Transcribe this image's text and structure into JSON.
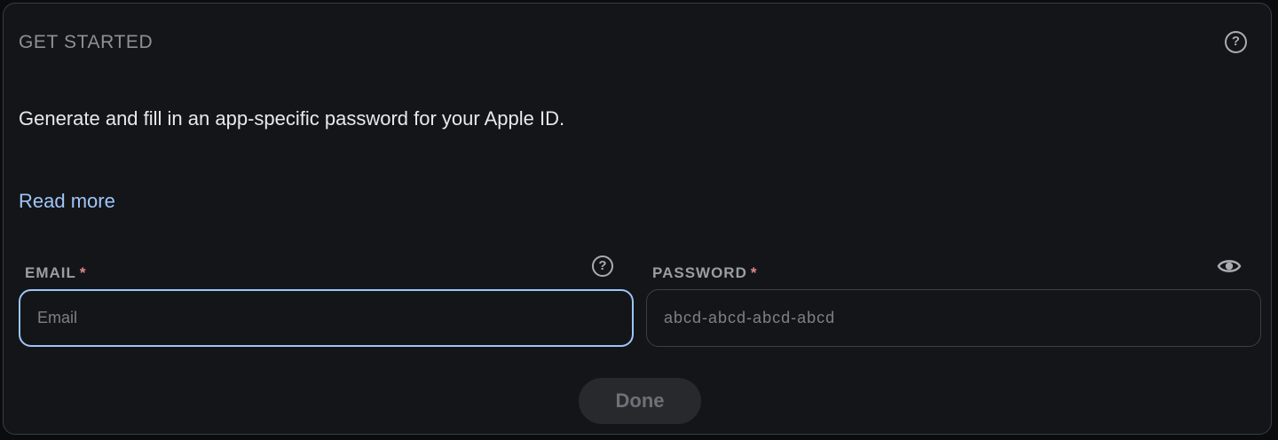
{
  "header": {
    "title": "GET STARTED",
    "help_icon": "help-circle-icon",
    "help_glyph": "?"
  },
  "main": {
    "description": "Generate and fill in an app-specific password for your Apple ID.",
    "read_more_label": "Read more"
  },
  "form": {
    "email": {
      "label": "EMAIL",
      "required_marker": "*",
      "placeholder": "Email",
      "value": "",
      "help_icon": "help-circle-icon"
    },
    "password": {
      "label": "PASSWORD",
      "required_marker": "*",
      "placeholder": "abcd-abcd-abcd-abcd",
      "value": "",
      "visibility_icon": "eye-icon"
    },
    "done_label": "Done"
  },
  "colors": {
    "background": "#141518",
    "accent": "#9ec5f8",
    "required": "#e08a8a",
    "border": "#3d3f44"
  }
}
